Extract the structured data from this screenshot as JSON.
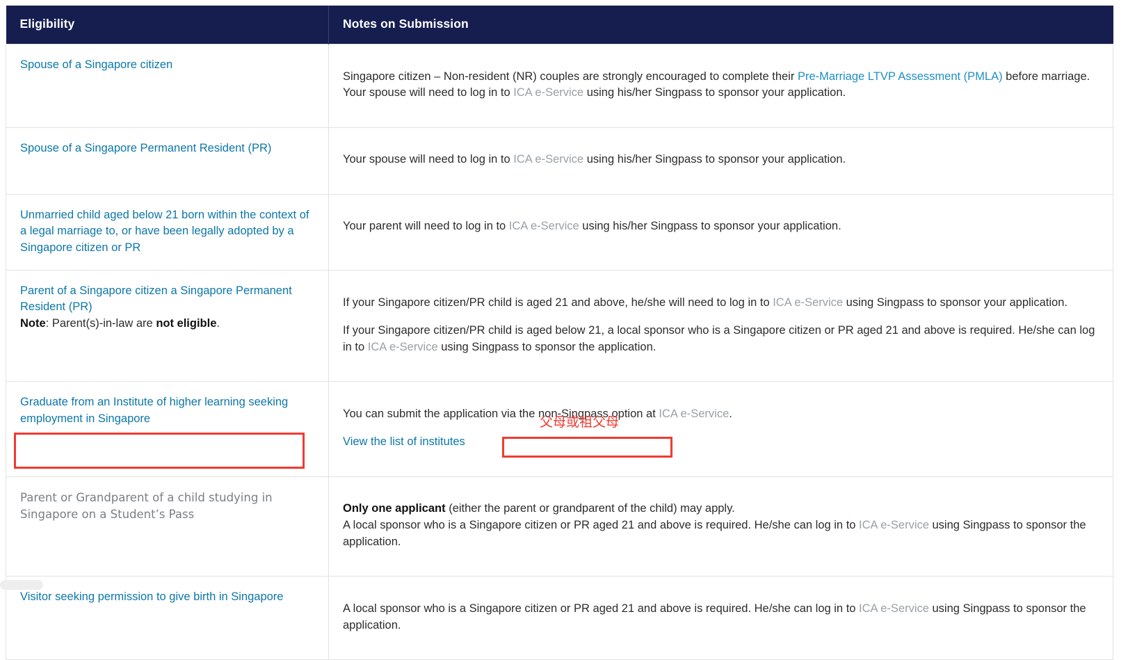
{
  "table": {
    "headers": {
      "eligibility": "Eligibility",
      "notes": "Notes on Submission"
    },
    "rows": [
      {
        "eligibility": "Spouse of a Singapore citizen",
        "notes_p1_seg1": "Singapore citizen – Non-resident (NR) couples are strongly encouraged to complete their ",
        "notes_p1_link1": "Pre-Marriage LTVP Assessment (PMLA)",
        "notes_p1_seg2": " before marriage. Your spouse will need to log in to ",
        "notes_p1_link2": "ICA e-Service",
        "notes_p1_seg3": " using his/her Singpass to sponsor your application."
      },
      {
        "eligibility": "Spouse of a Singapore Permanent Resident (PR)",
        "notes_p1_seg1": "Your spouse will need to log in to ",
        "notes_p1_link2": "ICA e-Service",
        "notes_p1_seg3": " using his/her Singpass to sponsor your application."
      },
      {
        "eligibility": "Unmarried child aged below 21 born within the context of a legal marriage to, or have been legally adopted by a Singapore citizen or PR",
        "notes_p1_seg1": "Your parent will need to log in to ",
        "notes_p1_link2": "ICA e-Service",
        "notes_p1_seg3": " using his/her Singpass to sponsor your application."
      },
      {
        "eligibility": "Parent of a Singapore citizen a Singapore Permanent Resident (PR)",
        "note_prefix": "Note",
        "note_mid": ": Parent(s)-in-law are ",
        "note_bold": "not eligible",
        "note_suffix": ".",
        "notes_p1_seg1": "If your Singapore citizen/PR child is aged 21 and above, he/she will need to log in to ",
        "notes_p1_link2": "ICA e-Service",
        "notes_p1_seg3": " using Singpass to sponsor your application.",
        "notes_p2_seg1": "If your Singapore citizen/PR child is aged below 21, a local sponsor who is a Singapore citizen or PR aged 21 and above is required. He/she can log in to ",
        "notes_p2_link": "ICA e-Service",
        "notes_p2_seg2": " using Singpass to sponsor the application."
      },
      {
        "eligibility": "Graduate from an Institute of higher learning seeking employment in Singapore",
        "notes_p1_seg1": "You can submit the application via the non-Singpass option at ",
        "notes_p1_link2": "ICA e-Service",
        "notes_p1_seg3": ".",
        "notes_p2_link": "View the list of institutes"
      },
      {
        "eligibility": "Parent or Grandparent of a child studying in Singapore on a Student’s Pass",
        "notes_p1_bold": "Only one applicant",
        "notes_p1_seg1": " (either ",
        "notes_p1_highlight": "the parent or grandparent",
        "notes_p1_seg2": " of the child) may apply.",
        "notes_p2_seg1": "A local sponsor who is a Singapore citizen or PR aged 21 and above is required. He/she can log in to ",
        "notes_p2_link": "ICA e-Service",
        "notes_p2_seg2": " using Singpass to sponsor the application."
      },
      {
        "eligibility": "Visitor seeking permission to give birth in Singapore",
        "notes_p2_seg1": "A local sponsor who is a Singapore citizen or PR aged 21 and above is required. He/she can log in to ",
        "notes_p2_link": "ICA e-Service",
        "notes_p2_seg2": " using Singpass to sponsor the application."
      }
    ]
  },
  "annotations": {
    "chinese_label": "父母或祖父母",
    "box_color": "#ef3b32",
    "text_color": "#ef3b32"
  },
  "colors": {
    "header_bg": "#161e50",
    "link_blue": "#0d77a8",
    "muted_link": "#9aa0a6",
    "border": "#e2e2e2",
    "plain_gray_text": "#7a7f85"
  }
}
